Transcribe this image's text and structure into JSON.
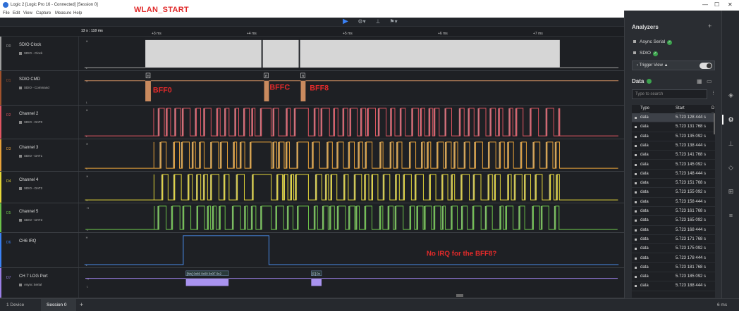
{
  "window": {
    "title": "Logic 2 [Logic Pro 16 - Connected] [Session 0]",
    "controls": [
      "—",
      "☐",
      "✕"
    ]
  },
  "menu": [
    "File",
    "Edit",
    "View",
    "Capture",
    "Measure",
    "Help"
  ],
  "annotations": {
    "wlan_start": "WLAN_START",
    "bff0": "BFF0",
    "bffc": "BFFC",
    "bff8": "BFF8",
    "no_irq": "No IRQ for the BFF8?"
  },
  "timeline": {
    "origin": "13 s : 110 ms",
    "ticks": [
      "+3 ms",
      "+4 ms",
      "+5 ms",
      "+6 ms",
      "+7 ms"
    ]
  },
  "channels": [
    {
      "num": "D0",
      "name": "SDIO Clock",
      "analyzer": "SDIO - Clock",
      "color": "#9e9e9e"
    },
    {
      "num": "D1",
      "name": "SDIO CMD",
      "analyzer": "SDIO - Command",
      "color": "#a0522d"
    },
    {
      "num": "D2",
      "name": "Channel 2",
      "analyzer": "SDIO - DAT0",
      "color": "#e05561"
    },
    {
      "num": "D3",
      "name": "Channel 3",
      "analyzer": "SDIO - DAT1",
      "color": "#e8a23a"
    },
    {
      "num": "D4",
      "name": "Channel 4",
      "analyzer": "SDIO - DAT2",
      "color": "#e6d83a"
    },
    {
      "num": "D5",
      "name": "Channel 5",
      "analyzer": "SDIO - DAT3",
      "color": "#6cc24a"
    },
    {
      "num": "D6",
      "name": "CH6 IRQ",
      "analyzer": "",
      "color": "#3b82f6"
    },
    {
      "num": "D7",
      "name": "CH 7 LOG Port",
      "analyzer": "Async Serial",
      "color": "#9b7fe6"
    }
  ],
  "level_marks": {
    "high": "H",
    "low": "L"
  },
  "cmd_labels": [
    "R",
    "R",
    "R"
  ],
  "serial_labels": {
    "first": "[Ws] 0x80 0x00 0x0F 0x2",
    "second": "[C] 0x"
  },
  "sidebar": {
    "analyzers_title": "Analyzers",
    "analyzers": [
      "Async Serial",
      "SDIO"
    ],
    "trigger_view": "Trigger View",
    "data_title": "Data",
    "search_placeholder": "Type to search",
    "columns": [
      "Type",
      "Start",
      "D"
    ],
    "rows": [
      {
        "type": "data",
        "start": "5.723 128 444 s"
      },
      {
        "type": "data",
        "start": "5.723 131 768 s"
      },
      {
        "type": "data",
        "start": "5.723 135 092 s"
      },
      {
        "type": "data",
        "start": "5.723 138 444 s"
      },
      {
        "type": "data",
        "start": "5.723 141 768 s"
      },
      {
        "type": "data",
        "start": "5.723 145 092 s"
      },
      {
        "type": "data",
        "start": "5.723 148 444 s"
      },
      {
        "type": "data",
        "start": "5.723 151 768 s"
      },
      {
        "type": "data",
        "start": "5.723 155 092 s"
      },
      {
        "type": "data",
        "start": "5.723 158 444 s"
      },
      {
        "type": "data",
        "start": "5.723 161 768 s"
      },
      {
        "type": "data",
        "start": "5.723 165 092 s"
      },
      {
        "type": "data",
        "start": "5.723 168 444 s"
      },
      {
        "type": "data",
        "start": "5.723 171 768 s"
      },
      {
        "type": "data",
        "start": "5.723 175 092 s"
      },
      {
        "type": "data",
        "start": "5.723 178 444 s"
      },
      {
        "type": "data",
        "start": "5.723 181 768 s"
      },
      {
        "type": "data",
        "start": "5.723 185 092 s"
      },
      {
        "type": "data",
        "start": "5.723 188 444 s"
      }
    ]
  },
  "bottom": {
    "device": "1 Device",
    "session": "Session 0",
    "add": "+",
    "zoom": "6 ms"
  },
  "icons": [
    "play-icon",
    "gear-icon",
    "measure-icon",
    "flag-icon",
    "layers-icon",
    "analyzer-icon",
    "extension-icon",
    "marker-icon",
    "grid-icon",
    "notes-icon"
  ]
}
